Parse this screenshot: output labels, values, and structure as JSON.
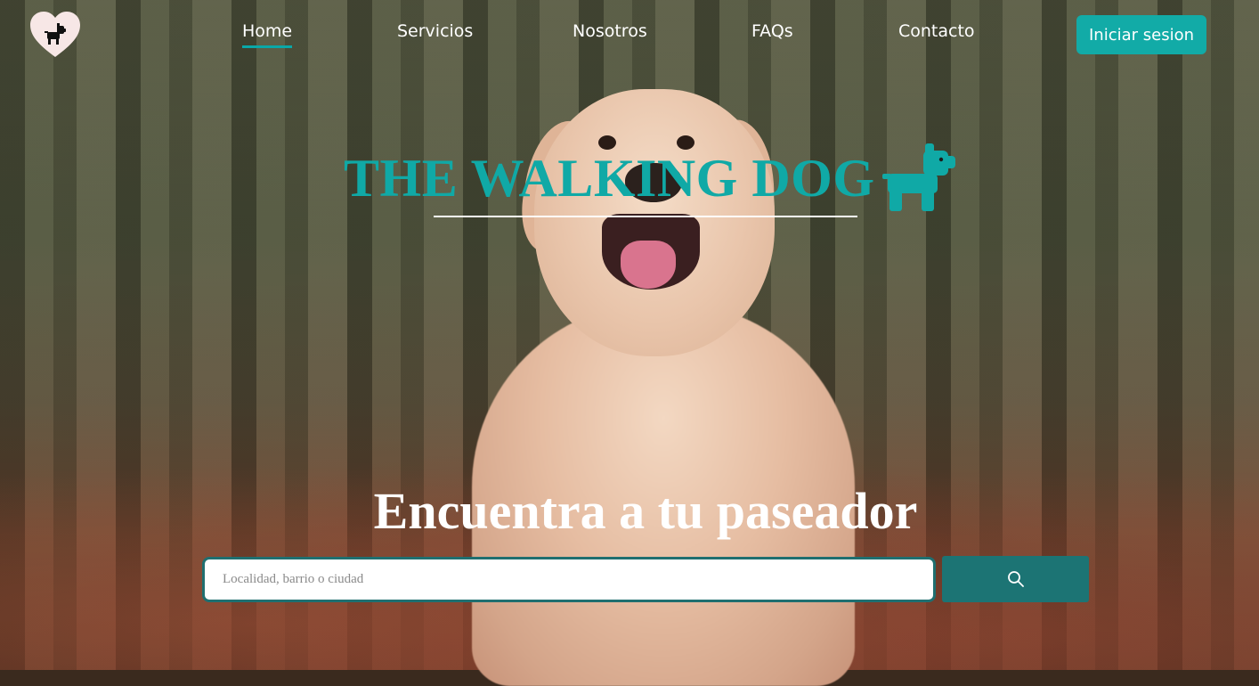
{
  "nav": {
    "items": [
      {
        "label": "Home",
        "active": true
      },
      {
        "label": "Servicios",
        "active": false
      },
      {
        "label": "Nosotros",
        "active": false
      },
      {
        "label": "FAQs",
        "active": false
      },
      {
        "label": "Contacto",
        "active": false
      }
    ],
    "login_label": "Iniciar sesion"
  },
  "brand": {
    "title": "THE WALKING DOG",
    "icon": "dog-icon"
  },
  "hero": {
    "heading": "Encuentra a tu paseador"
  },
  "search": {
    "placeholder": "Localidad, barrio o ciudad",
    "value": "",
    "button_icon": "search-icon"
  },
  "colors": {
    "accent": "#12aba7",
    "search_button": "#1c7474",
    "logo_bg": "#f7e7e6"
  }
}
